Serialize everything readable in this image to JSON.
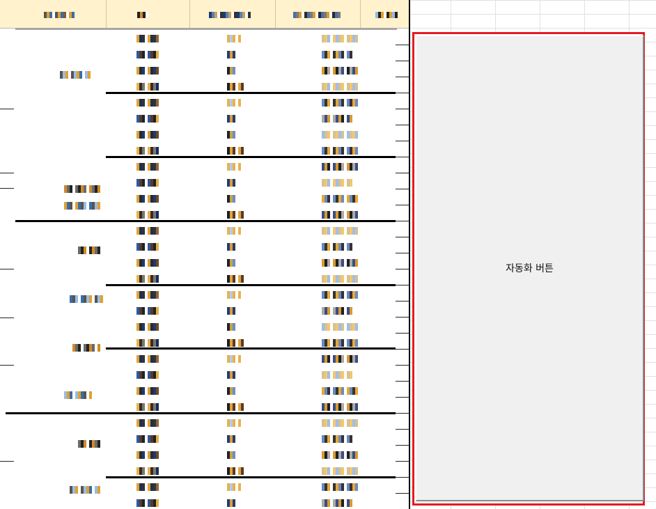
{
  "spreadsheet": {
    "header_cells": [
      {
        "id": "col-a",
        "colors": [
          "#7d5a3c",
          "#3a6ea5",
          "#e0a030",
          "#555555"
        ]
      },
      {
        "id": "col-b",
        "colors": [
          "#222222",
          "#d08a2a"
        ]
      },
      {
        "id": "col-c",
        "colors": [
          "#1f3a6b",
          "#e09a30",
          "#5a7fb0",
          "#333333",
          "#caa060"
        ]
      },
      {
        "id": "col-d",
        "colors": [
          "#2b2b2b",
          "#d89b35",
          "#4a6fa5",
          "#e0b060",
          "#7a7a7a"
        ]
      },
      {
        "id": "col-e",
        "colors": [
          "#222222",
          "#e0a030",
          "#9bb8e0"
        ]
      }
    ],
    "rows_col_b_palette": [
      [
        "#1c2f5a",
        "#e1a337",
        "#8a6a3a",
        "#333333"
      ],
      [
        "#5a3a2a",
        "#2d5aa0",
        "#e0b050",
        "#222222"
      ],
      [
        "#2a2a2a",
        "#d8a040",
        "#6b4a2a",
        "#1f3a6b"
      ],
      [
        "#3a2a1f",
        "#e8b24a",
        "#1c2c55",
        "#777777"
      ]
    ],
    "rows_col_c_palette": [
      [
        "#b0cde8",
        "#e4b450"
      ],
      [
        "#2a3a6b",
        "#d9a038"
      ],
      [
        "#222222",
        "#cfa04a",
        "#6d8fc0"
      ],
      [
        "#1e1e1e",
        "#e2a53a",
        "#5a3a2a"
      ]
    ],
    "rows_col_d_palette": [
      [
        "#f0c870",
        "#9bc0e8",
        "#d8c090"
      ],
      [
        "#333333",
        "#e8a838",
        "#6a8ac0"
      ],
      [
        "#1f1f1f",
        "#d79a33",
        "#3a4e86",
        "#aaaaaa"
      ]
    ],
    "group_labels_palette": [
      [
        "#3a6ea5",
        "#e0a030",
        "#9cbce0",
        "#555555"
      ],
      [
        "#222222",
        "#d08a2a",
        "#6a6a6a"
      ]
    ]
  },
  "automation": {
    "button_label": "자동화 버튼",
    "highlight_color": "#e21b23"
  }
}
